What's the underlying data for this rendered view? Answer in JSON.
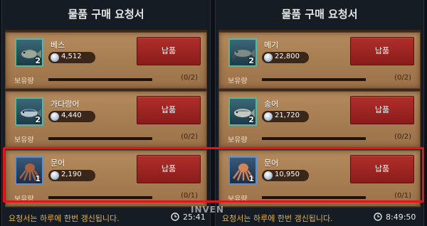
{
  "left": {
    "title": "물품 구매 요청서",
    "items": [
      {
        "name": "베스",
        "count": "2",
        "price": "4,512",
        "button": "납품",
        "stock_label": "보유량",
        "stock": "(0/2)"
      },
      {
        "name": "가다랑어",
        "count": "2",
        "price": "4,440",
        "button": "납품",
        "stock_label": "보유량",
        "stock": "(0/2)"
      },
      {
        "name": "문어",
        "count": "1",
        "price": "2,190",
        "button": "납품",
        "stock_label": "보유량",
        "stock": "(0/1)"
      }
    ],
    "notice": "요청서는 하루에 한번 갱신됩니다.",
    "timer": "25:41"
  },
  "right": {
    "title": "물품 구매 요청서",
    "items": [
      {
        "name": "메기",
        "count": "2",
        "price": "22,800",
        "button": "납품",
        "stock_label": "보유량",
        "stock": "(0/2)"
      },
      {
        "name": "송어",
        "count": "2",
        "price": "21,720",
        "button": "납품",
        "stock_label": "보유량",
        "stock": "(0/2)"
      },
      {
        "name": "문어",
        "count": "1",
        "price": "10,950",
        "button": "납품",
        "stock_label": "보유량",
        "stock": "(0/1)"
      }
    ],
    "notice": "요청서는 하루에 한번 갱신됩니다.",
    "timer": "8:49:50"
  },
  "watermark": "INVEN",
  "colors": {
    "button": "#9c2522",
    "notice": "#e3b04a",
    "highlight": "#e0161a",
    "card": "#a87e53"
  }
}
